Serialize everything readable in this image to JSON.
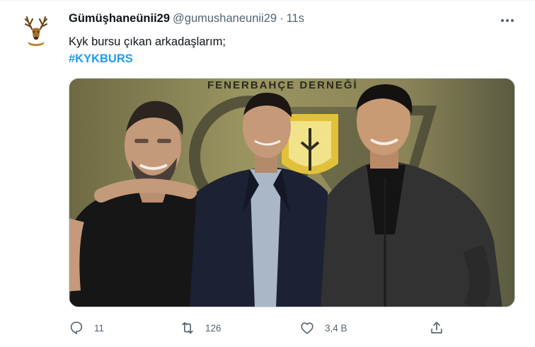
{
  "tweet": {
    "display_name": "Gümüşhaneünii29",
    "handle": "@gumushaneunii29",
    "separator": "·",
    "timestamp": "11s",
    "text": "Kyk bursu çıkan arkadaşlarım;",
    "hashtag": "#KYKBURS",
    "media": {
      "banner_text": "FENERBAHÇE DERNEĞİ"
    },
    "actions": {
      "reply_count": "11",
      "retweet_count": "126",
      "like_count": "3,4 B",
      "share_count": ""
    }
  },
  "icons": {
    "more": "more-horizontal-icon",
    "reply": "reply-icon",
    "retweet": "retweet-icon",
    "like": "heart-icon",
    "share": "share-icon"
  },
  "colors": {
    "link": "#1d9bf0",
    "secondary_text": "#536471",
    "primary_text": "#0f1419"
  }
}
